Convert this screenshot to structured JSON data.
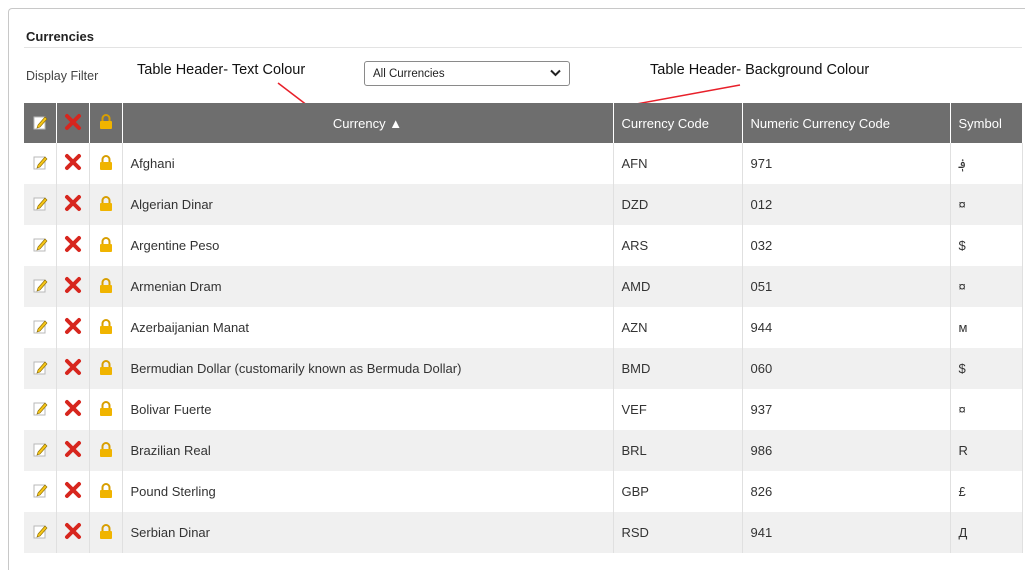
{
  "panel": {
    "title": "Currencies",
    "filter_label": "Display Filter",
    "filter_value": "All Currencies"
  },
  "annotations": {
    "text_colour": "Table Header- Text Colour",
    "background_colour": "Table Header- Background Colour"
  },
  "table": {
    "headers": {
      "currency": "Currency ▲",
      "code": "Currency Code",
      "numeric": "Numeric Currency Code",
      "symbol": "Symbol"
    },
    "rows": [
      {
        "name": "Afghani",
        "code": "AFN",
        "numeric": "971",
        "symbol": "؋"
      },
      {
        "name": "Algerian Dinar",
        "code": "DZD",
        "numeric": "012",
        "symbol": "¤"
      },
      {
        "name": "Argentine Peso",
        "code": "ARS",
        "numeric": "032",
        "symbol": "$"
      },
      {
        "name": "Armenian Dram",
        "code": "AMD",
        "numeric": "051",
        "symbol": "¤"
      },
      {
        "name": "Azerbaijanian Manat",
        "code": "AZN",
        "numeric": "944",
        "symbol": "м"
      },
      {
        "name": "Bermudian Dollar (customarily known as Bermuda Dollar)",
        "code": "BMD",
        "numeric": "060",
        "symbol": "$"
      },
      {
        "name": "Bolivar Fuerte",
        "code": "VEF",
        "numeric": "937",
        "symbol": "¤"
      },
      {
        "name": "Brazilian Real",
        "code": "BRL",
        "numeric": "986",
        "symbol": "R"
      },
      {
        "name": "Pound Sterling",
        "code": "GBP",
        "numeric": "826",
        "symbol": "£"
      },
      {
        "name": "Serbian Dinar",
        "code": "RSD",
        "numeric": "941",
        "symbol": "Д"
      }
    ]
  },
  "colors": {
    "header_bg": "#6e6e6e",
    "header_text": "#ffffff",
    "annotation_arrow": "#e8202a",
    "delete_icon": "#d7261e",
    "lock_icon": "#f0b400"
  },
  "icons": {
    "edit": "pencil-notepad-icon",
    "delete": "red-x-icon",
    "lock": "padlock-icon"
  }
}
